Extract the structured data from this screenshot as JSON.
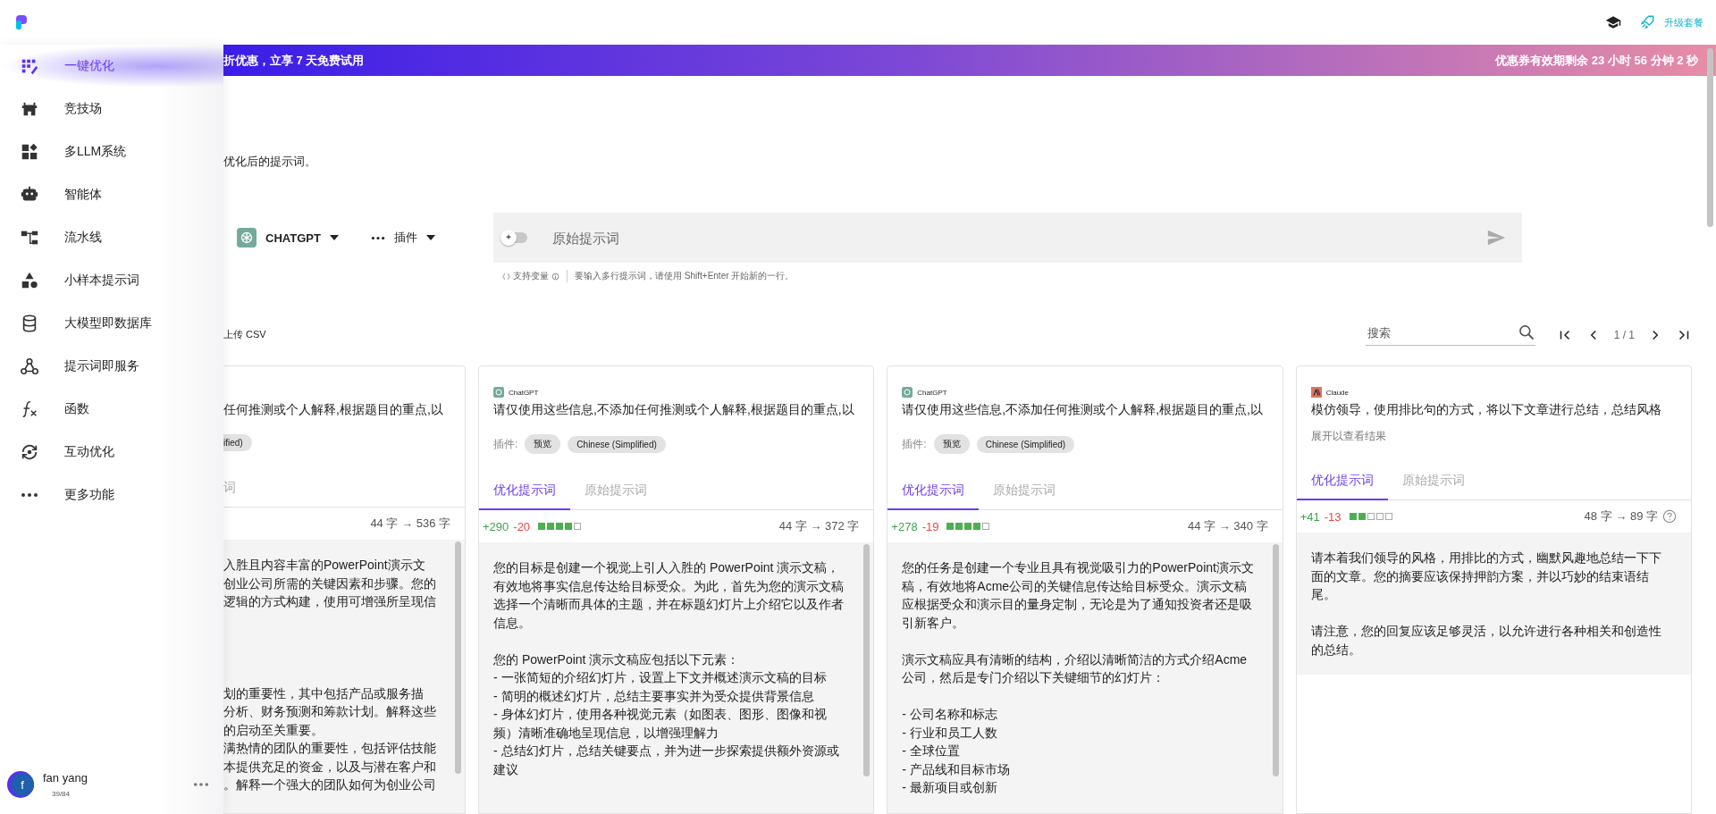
{
  "header": {
    "upgrade_label": "升级套餐"
  },
  "banner": {
    "left_text": "折优惠，立享 7 天免费试用",
    "right_text": "优惠券有效期剩余  23 小时  56 分钟  2 秒"
  },
  "sidebar": {
    "items": [
      {
        "label": "一键优化",
        "selected": true
      },
      {
        "label": "竞技场",
        "selected": false
      },
      {
        "label": "多LLM系统",
        "selected": false
      },
      {
        "label": "智能体",
        "selected": false
      },
      {
        "label": "流水线",
        "selected": false
      },
      {
        "label": "小样本提示词",
        "selected": false
      },
      {
        "label": "大模型即数据库",
        "selected": false
      },
      {
        "label": "提示词即服务",
        "selected": false
      },
      {
        "label": "函数",
        "selected": false
      },
      {
        "label": "互动优化",
        "selected": false
      },
      {
        "label": "更多功能",
        "selected": false
      }
    ],
    "user": {
      "initial": "f",
      "name": "fan yang",
      "usage": "39/84"
    }
  },
  "intro_text": "优化后的提示词。",
  "composer": {
    "model": "CHATGPT",
    "plugins_label": "插件",
    "enhance_on": false,
    "placeholder": "原始提示词",
    "variables_label": "支持变量",
    "hint": "要输入多行提示词，请使用 Shift+Enter 开始新的一行。"
  },
  "toolbar": {
    "upload_label": "上传 CSV",
    "search_placeholder": "搜索",
    "page": "1 / 1"
  },
  "cards": [
    {
      "prompt": "任何推测或个人解释,根据题目的重点,以",
      "chips": [
        "ified)"
      ],
      "tabs": [
        {
          "label": "词",
          "selected": false
        }
      ],
      "count": "44 字 → 536 字",
      "scrollable": true,
      "body": [
        [
          "入胜且内容丰富的PowerPoint演示文",
          "创业公司所需的关键因素和步骤。您的",
          "逻辑的方式构建，使用可增强所呈现信"
        ],
        [
          "划的重要性，其中包括产品或服务描",
          "分析、财务预测和筹款计划。解释这些",
          "的启动至关重要。",
          "满热情的团队的重要性，包括评估技能",
          "本提供充足的资金，以及与潜在客户和",
          "。解释一个强大的团队如何为创业公司"
        ]
      ]
    },
    {
      "model": "ChatGPT",
      "kind": "openai",
      "prompt": "请仅使用这些信息,不添加任何推测或个人解释,根据题目的重点,以",
      "plugins_label": "插件:",
      "chips": [
        "预览",
        "Chinese (Simplified)"
      ],
      "tabs": [
        {
          "label": "优化提示词",
          "selected": true
        },
        {
          "label": "原始提示词",
          "selected": false
        }
      ],
      "added": "+290",
      "removed": "-20",
      "stars": 4,
      "count": "44 字 → 372 字",
      "scrollable": true,
      "body": [
        [
          "您的目标是创建一个视觉上引人入胜的 PowerPoint 演示文稿，有效地将事实信息传达给目标受众。为此，首先为您的演示文稿选择一个清晰而具体的主题，并在标题幻灯片上介绍它以及作者信息。"
        ],
        [
          "您的 PowerPoint 演示文稿应包括以下元素：",
          "- 一张简短的介绍幻灯片，设置上下文并概述演示文稿的目标",
          "- 简明的概述幻灯片，总结主要事实并为受众提供背景信息",
          "- 身体幻灯片，使用各种视觉元素（如图表、图形、图像和视频）清晰准确地呈现信息，以增强理解力",
          "- 总结幻灯片，总结关键要点，并为进一步探索提供额外资源或建议"
        ]
      ]
    },
    {
      "model": "ChatGPT",
      "kind": "openai",
      "prompt": "请仅使用这些信息,不添加任何推测或个人解释,根据题目的重点,以",
      "plugins_label": "插件:",
      "chips": [
        "预览",
        "Chinese (Simplified)"
      ],
      "tabs": [
        {
          "label": "优化提示词",
          "selected": true
        },
        {
          "label": "原始提示词",
          "selected": false
        }
      ],
      "added": "+278",
      "removed": "-19",
      "stars": 4,
      "count": "44 字 → 340 字",
      "scrollable": true,
      "body": [
        [
          "您的任务是创建一个专业且具有视觉吸引力的PowerPoint演示文稿，有效地将Acme公司的关键信息传达给目标受众。演示文稿应根据受众和演示目的量身定制，无论是为了通知投资者还是吸引新客户。"
        ],
        [
          "演示文稿应具有清晰的结构，介绍以清晰简洁的方式介绍Acme公司，然后是专门介绍以下关键细节的幻灯片："
        ],
        [
          "- 公司名称和标志",
          "- 行业和员工人数",
          "- 全球位置",
          "- 产品线和目标市场",
          "- 最新项目或创新"
        ]
      ]
    },
    {
      "model": "Claude",
      "kind": "claude",
      "prompt": "模仿领导，使用排比句的方式，将以下文章进行总结，总结风格",
      "expand_hint": "展开以查看结果",
      "tabs": [
        {
          "label": "优化提示词",
          "selected": true
        },
        {
          "label": "原始提示词",
          "selected": false
        }
      ],
      "added": "+41",
      "removed": "-13",
      "stars": 2,
      "count": "48 字 → 89 字",
      "help": true,
      "scrollable": false,
      "body": [
        [
          "请本着我们领导的风格，用排比的方式，幽默风趣地总结一下下面的文章。您的摘要应该保持押韵方案，并以巧妙的结束语结尾。"
        ],
        [
          "请注意，您的回复应该足够灵活，以允许进行各种相关和创造性的总结。"
        ]
      ]
    }
  ]
}
